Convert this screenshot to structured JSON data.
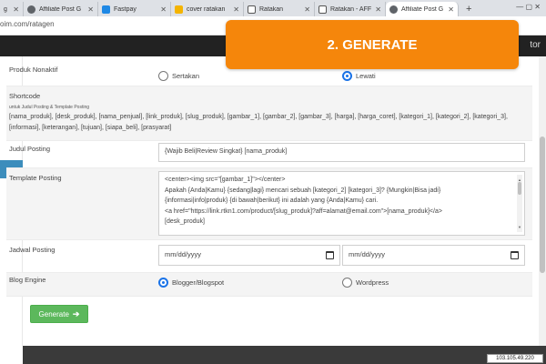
{
  "browser": {
    "tabs": [
      {
        "label": "g",
        "favicon_color": "#e0e0e0"
      },
      {
        "label": "Affiliate Post G",
        "favicon_color": "#5f6368"
      },
      {
        "label": "Fastpay",
        "favicon_color": "#1e88e5"
      },
      {
        "label": "cover ratakan",
        "favicon_color": "#f4b400"
      },
      {
        "label": "Ratakan",
        "favicon_color": "#555555"
      },
      {
        "label": "Ratakan - AFF",
        "favicon_color": "#555555"
      },
      {
        "label": "Affiliate Post G",
        "favicon_color": "#5f6368"
      }
    ],
    "new_tab": "+",
    "window_controls": "—   ▢   ✕",
    "url": "oim.com/ratagen"
  },
  "header": {
    "right_text": "tor"
  },
  "banner": {
    "text": "2. GENERATE"
  },
  "form": {
    "produk_nonaktif": {
      "label": "Produk Nonaktif",
      "options": [
        {
          "label": "Sertakan",
          "selected": false
        },
        {
          "label": "Lewati",
          "selected": true
        }
      ]
    },
    "shortcode": {
      "label": "Shortcode",
      "note": "untuk Judul Posting & Template Posting",
      "list": "[nama_produk], [desk_produk], [nama_penjual], [link_produk], [slug_produk], [gambar_1], [gambar_2], [gambar_3], [harga], [harga_coret], [kategori_1], [kategori_2], [kategori_3], [informasi], [keterangan], [tujuan], [siapa_beli], [prasyarat]"
    },
    "judul_posting": {
      "label": "Judul Posting",
      "value": "{Wajib Beli|Review Singkat} [nama_produk]"
    },
    "template_posting": {
      "label": "Template Posting",
      "lines": [
        "<center><img src=\"[gambar_1]\"></center>",
        "Apakah {Anda|Kamu} {sedang|lagi} mencari sebuah [kategori_2] [kategori_3]? {Mungkin|Bisa jadi}",
        "{informasi|info|produk} {di bawah|berikut} ini adalah yang {Anda|Kamu} cari.",
        "<a href=\"https://link.rtkn1.com/product/[slug_produk]?aff=alamat@email.com\">[nama_produk]</a>",
        "[desk_produk]"
      ]
    },
    "jadwal_posting": {
      "label": "Jadwal Posting",
      "start_placeholder": "mm/dd/yyyy",
      "end_placeholder": "mm/dd/yyyy"
    },
    "blog_engine": {
      "label": "Blog Engine",
      "options": [
        {
          "label": "Blogger/Blogspot",
          "selected": true
        },
        {
          "label": "Wordpress",
          "selected": false
        }
      ]
    },
    "generate_button": {
      "label": "Generate",
      "arrow": "➔"
    }
  },
  "footer": {
    "ip": "103.105.49.220"
  },
  "colors": {
    "banner": "#f5860b",
    "generate_button": "#5cb85c",
    "radio_selected": "#1a73e8",
    "header": "#222222",
    "footer": "#3a3a3a"
  }
}
